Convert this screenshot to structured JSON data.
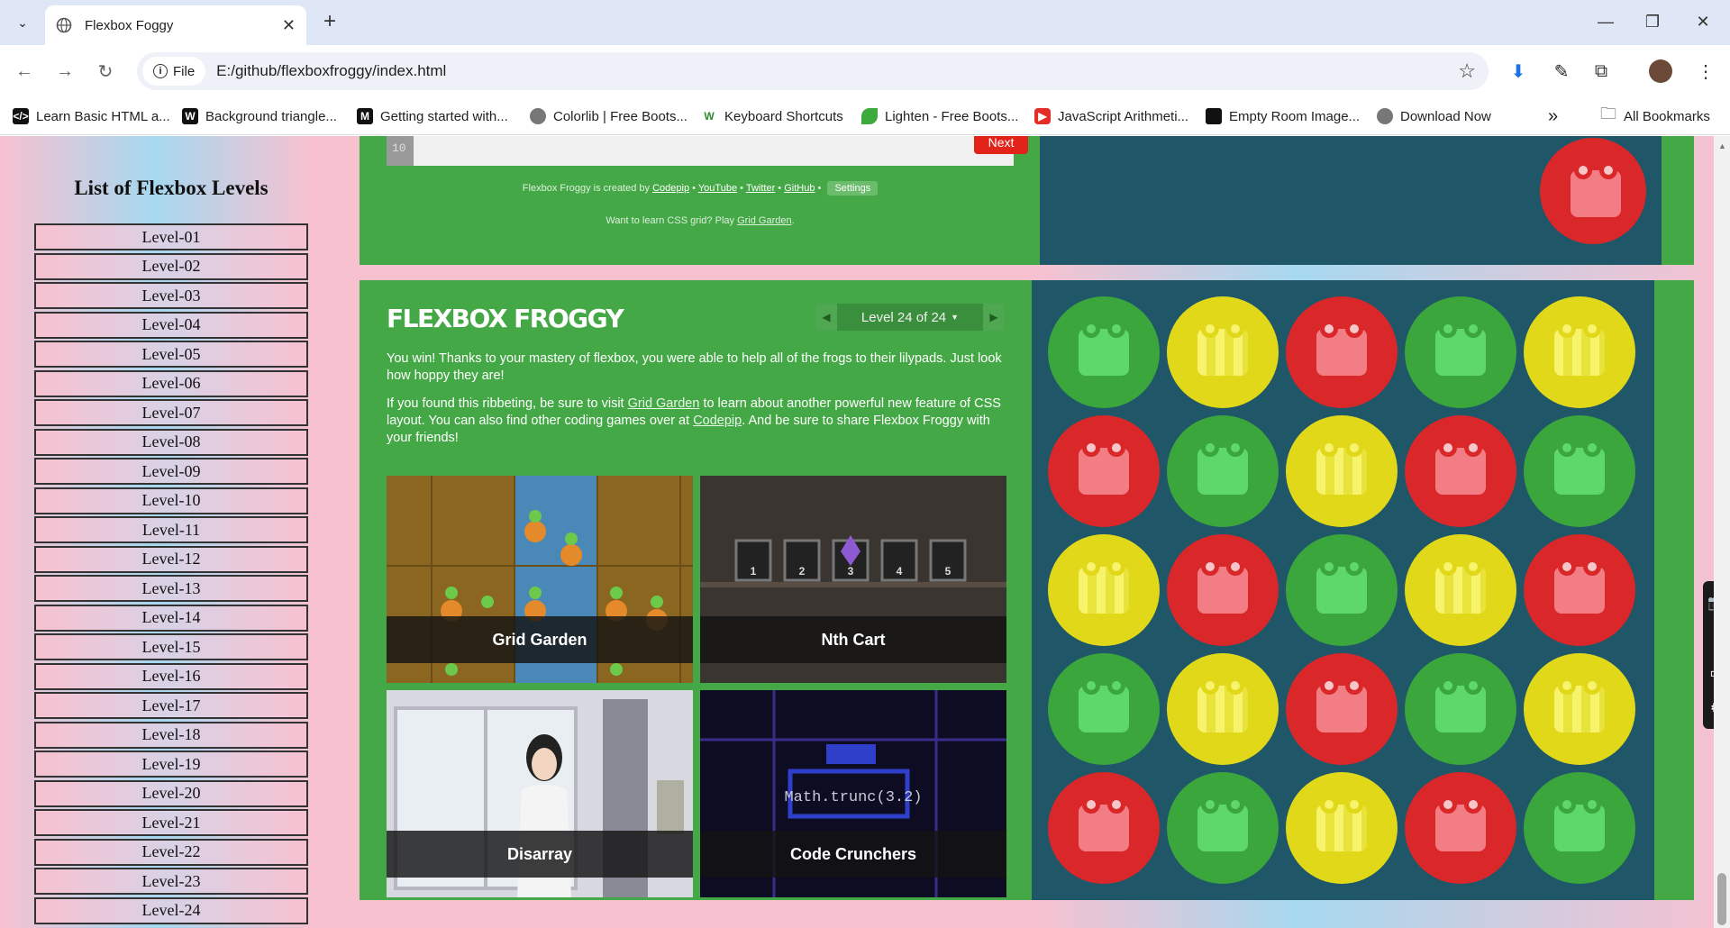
{
  "browser": {
    "tab_title": "Flexbox Foggy",
    "url": "E:/github/flexboxfroggy/index.html",
    "site_info_label": "File",
    "bookmarks": [
      {
        "label": "Learn Basic HTML a...",
        "icon": "w3-icon",
        "color": "#222"
      },
      {
        "label": "Background triangle...",
        "icon": "w-icon",
        "color": "#222"
      },
      {
        "label": "Getting started with...",
        "icon": "m-icon",
        "color": "#222"
      },
      {
        "label": "Colorlib | Free Boots...",
        "icon": "globe-icon",
        "color": "#666"
      },
      {
        "label": "Keyboard Shortcuts",
        "icon": "w3-green-icon",
        "color": "#2e8b2e"
      },
      {
        "label": "Lighten - Free Boots...",
        "icon": "leaf-icon",
        "color": "#3caa3c"
      },
      {
        "label": "JavaScript Arithmeti...",
        "icon": "youtube-icon",
        "color": "#e52d27"
      },
      {
        "label": "Empty Room Image...",
        "icon": "square-icon",
        "color": "#111"
      },
      {
        "label": "Download Now",
        "icon": "globe-icon",
        "color": "#666"
      }
    ],
    "more_bookmarks": "»",
    "all_bookmarks": "All Bookmarks"
  },
  "sidebar": {
    "title": "List of Flexbox Levels",
    "levels": [
      "Level-01",
      "Level-02",
      "Level-03",
      "Level-04",
      "Level-05",
      "Level-06",
      "Level-07",
      "Level-08",
      "Level-09",
      "Level-10",
      "Level-11",
      "Level-12",
      "Level-13",
      "Level-14",
      "Level-15",
      "Level-16",
      "Level-17",
      "Level-18",
      "Level-19",
      "Level-20",
      "Level-21",
      "Level-22",
      "Level-23",
      "Level-24"
    ]
  },
  "top_panel": {
    "line_number": "10",
    "next_label": "Next",
    "credits_prefix": "Flexbox Froggy is created by",
    "credits_links": [
      "Codepip",
      "YouTube",
      "Twitter",
      "GitHub"
    ],
    "settings_label": "Settings",
    "css_grid_prefix": "Want to learn CSS grid? Play",
    "css_grid_link": "Grid Garden"
  },
  "main_panel": {
    "logo": "FLEXBOX FROGGY",
    "level_indicator": "Level 24 of 24",
    "para1": "You win! Thanks to your mastery of flexbox, you were able to help all of the frogs to their lilypads. Just look how hoppy they are!",
    "para2_a": "If you found this ribbeting, be sure to visit",
    "para2_link1": "Grid Garden",
    "para2_b": "to learn about another powerful new feature of CSS layout. You can also find other coding games over at",
    "para2_link2": "Codepip",
    "para2_c": ". And be sure to share Flexbox Froggy with your friends!",
    "cards": [
      "Grid Garden",
      "Nth Cart",
      "Disarray",
      "Code Crunchers"
    ],
    "nth_cart_numbers": [
      "1",
      "2",
      "3",
      "4",
      "5"
    ],
    "code_crunchers_text": "Math.trunc(3.2)"
  },
  "board": {
    "pads": [
      [
        "green",
        "yellow",
        "red",
        "green",
        "yellow"
      ],
      [
        "red",
        "green",
        "yellow",
        "red",
        "green"
      ],
      [
        "yellow",
        "red",
        "green",
        "yellow",
        "red"
      ],
      [
        "green",
        "yellow",
        "red",
        "green",
        "yellow"
      ],
      [
        "red",
        "green",
        "yellow",
        "red",
        "green"
      ]
    ]
  },
  "colors": {
    "panel_green": "#45a847",
    "board_blue": "#1f5768",
    "frog_green": "#3aa63c",
    "frog_yellow": "#e2d81a",
    "frog_red": "#d9272a"
  }
}
